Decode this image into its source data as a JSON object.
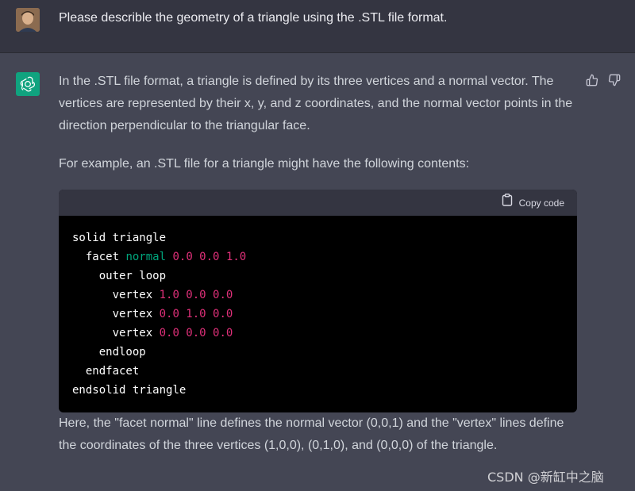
{
  "user_message": "Please describle the geometry of a triangle using the .STL file format.",
  "assistant": {
    "paragraph1": "In the .STL file format, a triangle is defined by its three vertices and a normal vector. The vertices are represented by their x, y, and z coordinates, and the normal vector points in the direction perpendicular to the triangular face.",
    "paragraph2": "For example, an .STL file for a triangle might have the following contents:",
    "code_copy_label": "Copy code",
    "code": {
      "l1_kw": "solid",
      "l1_name": "triangle",
      "l2_kw": "facet",
      "l2_normal": "normal",
      "l2_nums": "0.0 0.0 1.0",
      "l3": "outer loop",
      "vertex_kw": "vertex",
      "v1": "1.0 0.0 0.0",
      "v2": "0.0 1.0 0.0",
      "v3": "0.0 0.0 0.0",
      "l7": "endloop",
      "l8": "endfacet",
      "l9_kw": "endsolid",
      "l9_name": "triangle"
    },
    "paragraph3": "Here, the \"facet normal\" line defines the normal vector (0,0,1) and the \"vertex\" lines define the coordinates of the three vertices (1,0,0), (0,1,0), and (0,0,0) of the triangle."
  },
  "watermark": "CSDN @新缸中之脑",
  "icons": {
    "thumbs_up": "thumbs-up-icon",
    "thumbs_down": "thumbs-down-icon",
    "clipboard": "clipboard-icon",
    "openai_logo": "openai-logo-icon"
  },
  "colors": {
    "accent": "#10a37f",
    "code_keyword_normal": "#00a67d",
    "code_number": "#df3079"
  }
}
